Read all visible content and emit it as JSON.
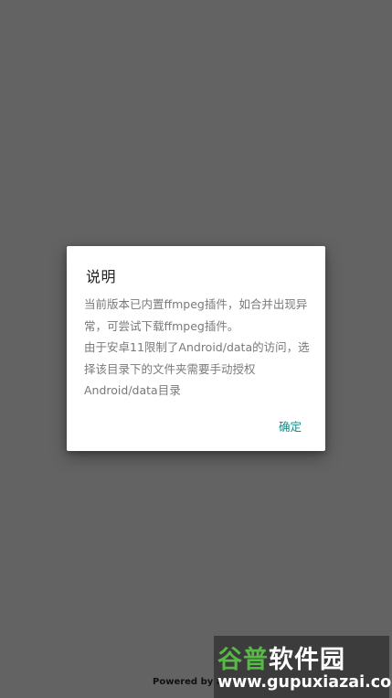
{
  "dialog": {
    "title": "说明",
    "paragraph1": "当前版本已内置ffmpeg插件，如合并出现异常，可尝试下载ffmpeg插件。",
    "paragraph2": "由于安卓11限制了Android/data的访问，选择该目录下的文件夹需要手动授权Android/data目录",
    "confirm_label": "确定"
  },
  "footer": {
    "powered_by": "Powered by a"
  },
  "watermark": {
    "brand_green": "谷普",
    "brand_white": "软件园",
    "url": "www.gupuxiazai.com"
  },
  "colors": {
    "scrim": "#636363",
    "accent": "#0e8f86",
    "watermark_green": "#58b848"
  }
}
